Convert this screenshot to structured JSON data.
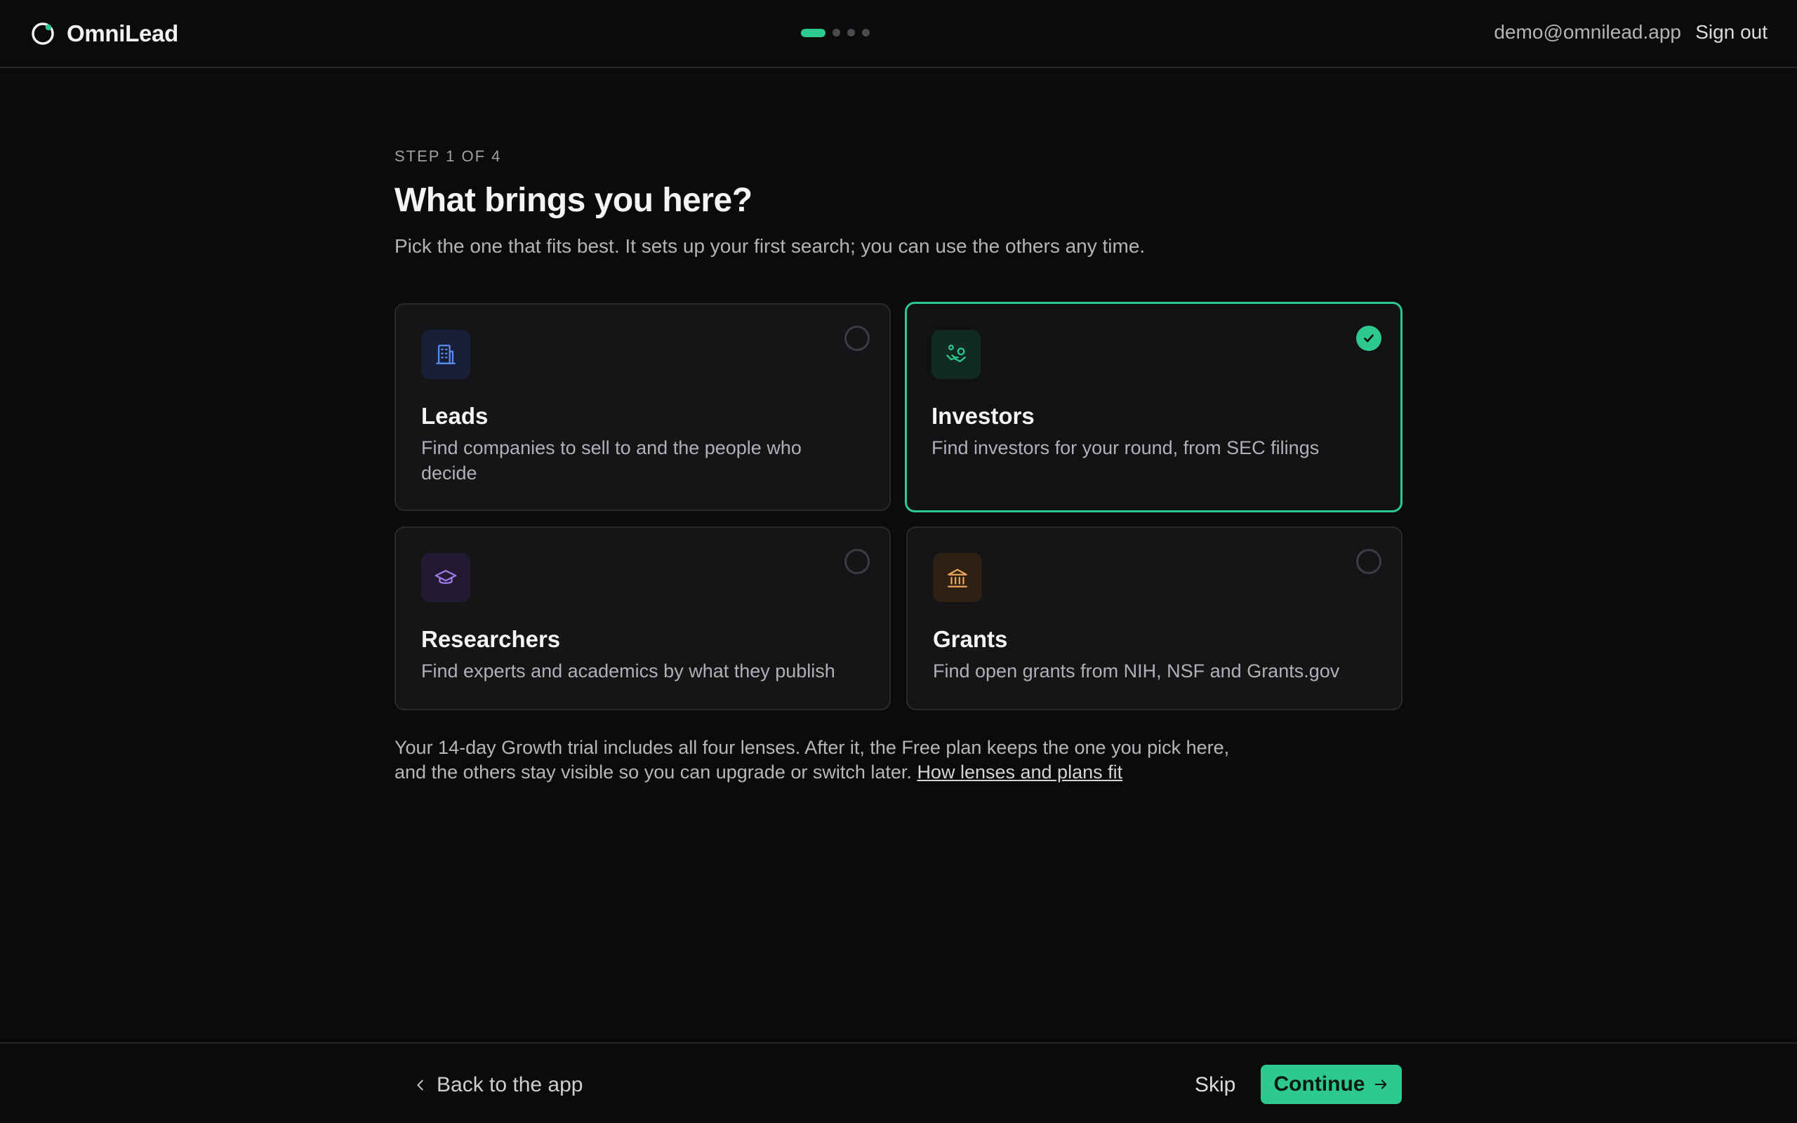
{
  "header": {
    "brand": "OmniLead",
    "progress": {
      "current_step": 1,
      "total_steps": 4
    },
    "user_email": "demo@omnilead.app",
    "sign_out": "Sign out"
  },
  "main": {
    "step_label": "STEP 1 OF 4",
    "title": "What brings you here?",
    "subtitle": "Pick the one that fits best. It sets up your first search; you can use the others any time.",
    "options": [
      {
        "title": "Leads",
        "description": "Find companies to sell to and the people who decide",
        "icon": "building-icon",
        "selected": false
      },
      {
        "title": "Investors",
        "description": "Find investors for your round, from SEC filings",
        "icon": "hand-coins-icon",
        "selected": true
      },
      {
        "title": "Researchers",
        "description": "Find experts and academics by what they publish",
        "icon": "graduation-cap-icon",
        "selected": false
      },
      {
        "title": "Grants",
        "description": "Find open grants from NIH, NSF and Grants.gov",
        "icon": "landmark-icon",
        "selected": false
      }
    ],
    "note_text": "Your 14-day Growth trial includes all four lenses. After it, the Free plan keeps the one you pick here, and the others stay visible so you can upgrade or switch later.",
    "note_link": "How lenses and plans fit"
  },
  "footer": {
    "back_label": "Back to the app",
    "skip_label": "Skip",
    "continue_label": "Continue"
  },
  "colors": {
    "accent": "#2ec98e",
    "background": "#0b0b0c",
    "card": "#151517",
    "leads_icon": "#5b8def",
    "researchers_icon": "#a07ce8",
    "grants_icon": "#e9a55a"
  }
}
